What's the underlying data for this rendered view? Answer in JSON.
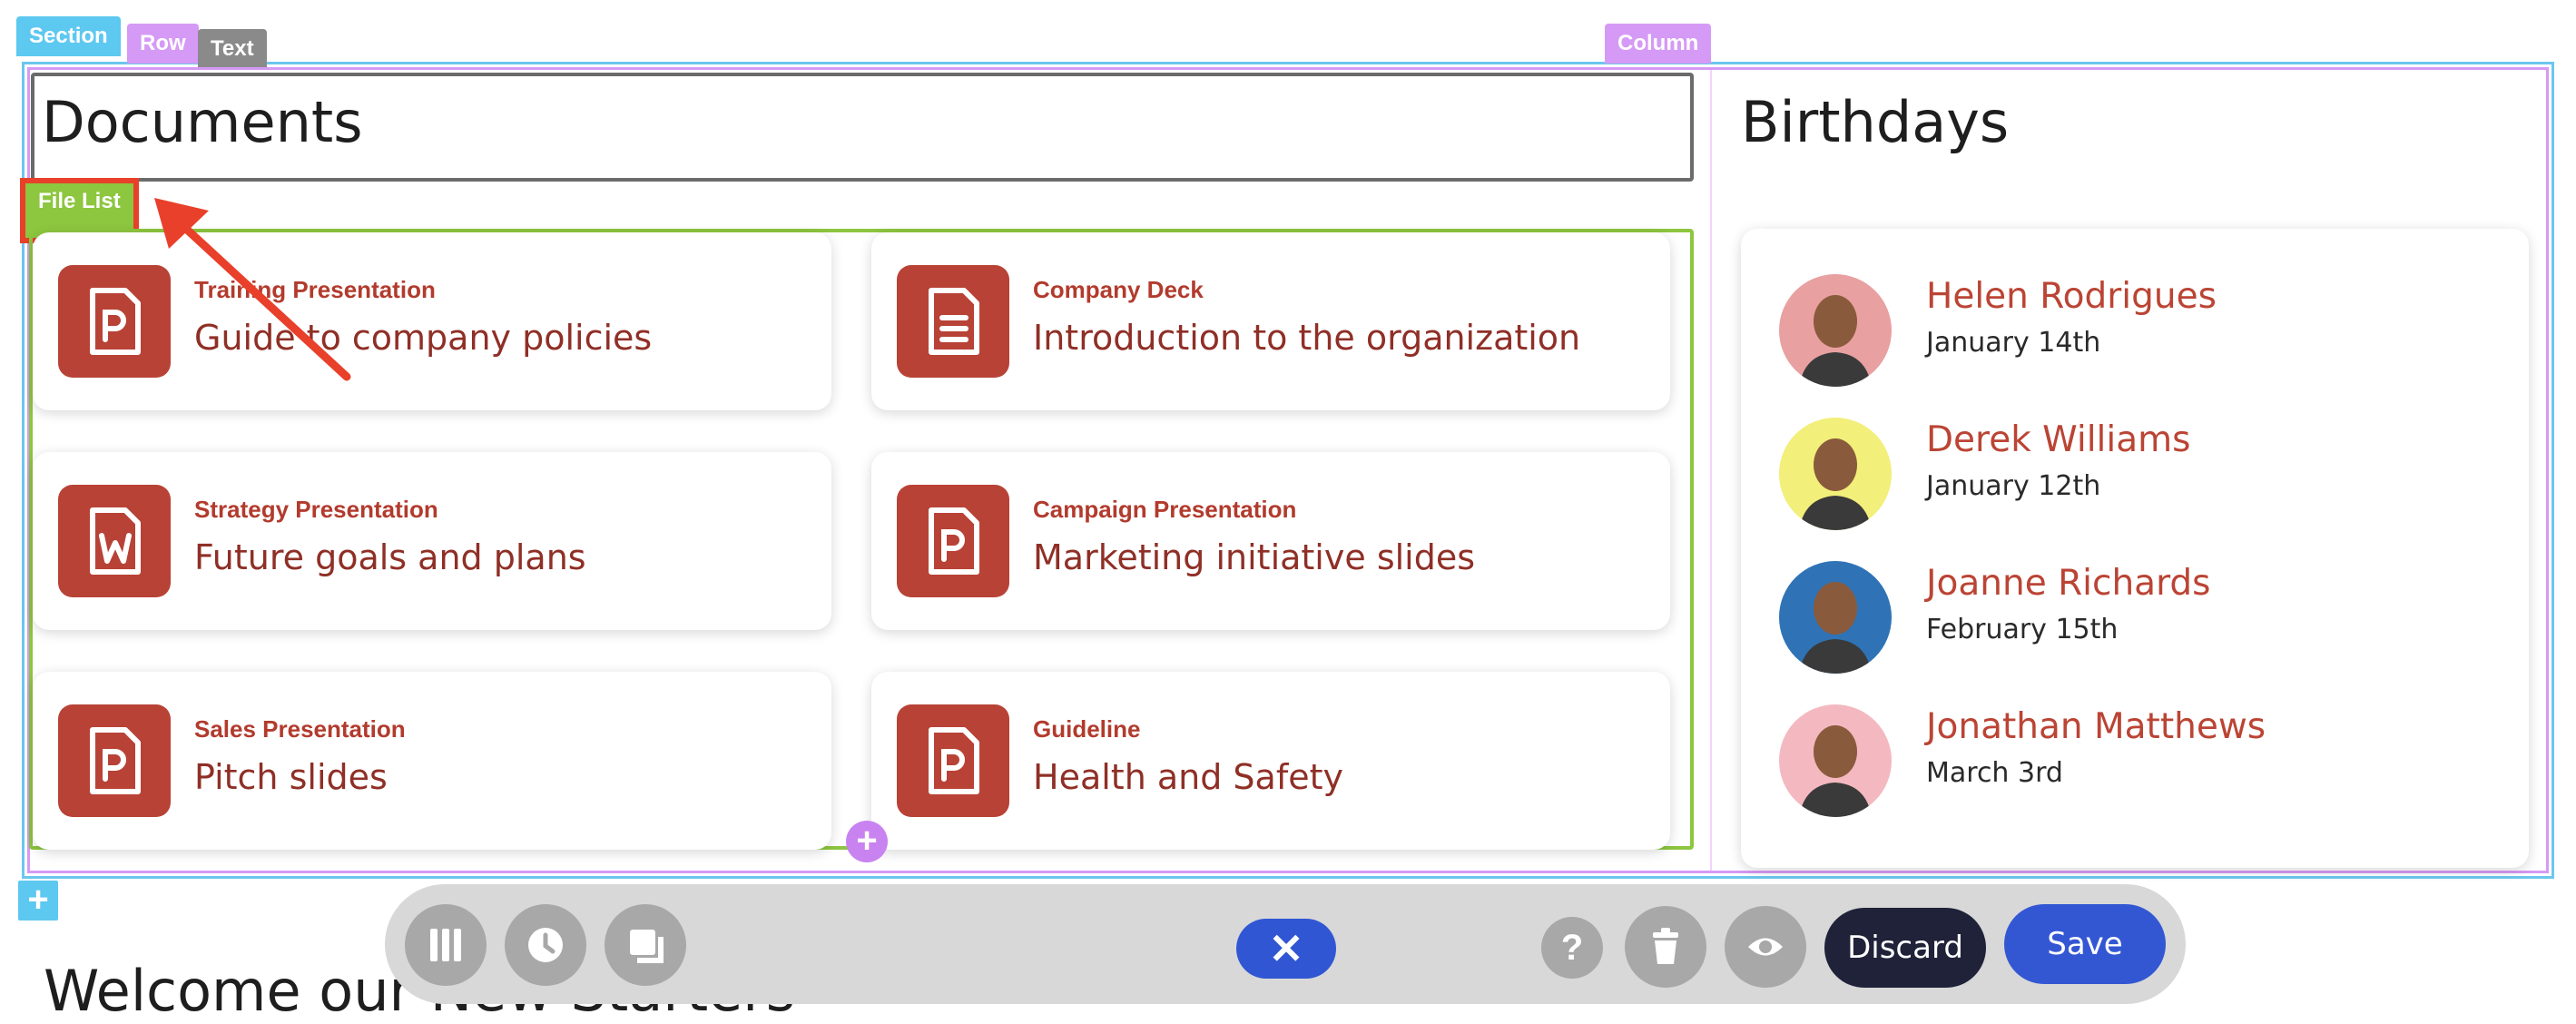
{
  "editor_tags": {
    "section": "Section",
    "row": "Row",
    "text": "Text",
    "column": "Column",
    "file_list": "File List"
  },
  "documents": {
    "heading": "Documents",
    "files": [
      {
        "title": "Training Presentation",
        "description": "Guide to company policies",
        "icon": "powerpoint-file-icon"
      },
      {
        "title": "Company Deck",
        "description": "Introduction to the organization",
        "icon": "document-file-icon"
      },
      {
        "title": "Strategy Presentation",
        "description": "Future goals and plans",
        "icon": "word-file-icon"
      },
      {
        "title": "Campaign Presentation",
        "description": "Marketing initiative slides",
        "icon": "powerpoint-file-icon"
      },
      {
        "title": "Sales Presentation",
        "description": "Pitch slides",
        "icon": "powerpoint-file-icon"
      },
      {
        "title": "Guideline",
        "description": "Health and Safety",
        "icon": "powerpoint-file-icon"
      }
    ]
  },
  "birthdays": {
    "heading": "Birthdays",
    "people": [
      {
        "name": "Helen Rodrigues",
        "date": "January 14th",
        "avatar_bg": "#e9a0a0"
      },
      {
        "name": "Derek Williams",
        "date": "January 12th",
        "avatar_bg": "#f2ef7a"
      },
      {
        "name": "Joanne Richards",
        "date": "February 15th",
        "avatar_bg": "#2f73b6"
      },
      {
        "name": "Jonathan Matthews",
        "date": "March 3rd",
        "avatar_bg": "#f4b9c0"
      }
    ]
  },
  "next_section": {
    "heading": "Welcome our New Starters"
  },
  "toolbar": {
    "close_label": "✕",
    "help_label": "?",
    "discard_label": "Discard",
    "save_label": "Save"
  },
  "colors": {
    "accent_red": "#b84236",
    "save_blue": "#3357d3",
    "discard_dark": "#1f2239"
  }
}
